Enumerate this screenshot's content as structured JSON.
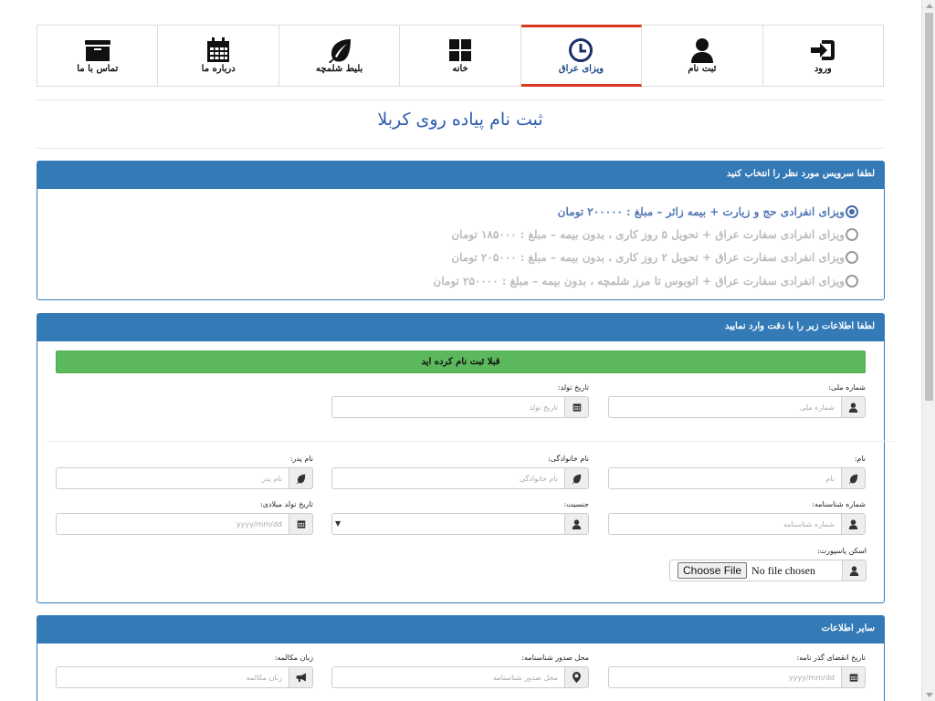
{
  "nav": {
    "items": [
      {
        "key": "login",
        "label": "ورود",
        "icon": "sign-in-icon"
      },
      {
        "key": "register",
        "label": "ثبت نام",
        "icon": "user-icon"
      },
      {
        "key": "iraq-visa",
        "label": "ویزای عراق",
        "icon": "clock-icon",
        "active": true
      },
      {
        "key": "home",
        "label": "خانه",
        "icon": "grid-icon"
      },
      {
        "key": "shalamcheh-ticket",
        "label": "بلیط شلمچه",
        "icon": "leaf-icon"
      },
      {
        "key": "about",
        "label": "درباره ما",
        "icon": "calendar-icon"
      },
      {
        "key": "contact",
        "label": "تماس با ما",
        "icon": "folder-icon"
      }
    ]
  },
  "page_title": "ثبت نام پیاده روی کربلا",
  "services_panel": {
    "title": "لطفا سرویس مورد نظر را انتخاب کنید",
    "options": [
      {
        "label": "ویزای انفرادی حج و زیارت + بیمه زائر – مبلغ : ۲۰۰۰۰۰ تومان",
        "checked": true
      },
      {
        "label": "ویزای انفرادی سفارت عراق + تحویل ۵ روز کاری ، بدون بیمه – مبلغ : ۱۸۵۰۰۰ تومان",
        "checked": false
      },
      {
        "label": "ویزای انفرادی سفارت عراق + تحویل ۲ روز کاری ، بدون بیمه – مبلغ : ۲۰۵۰۰۰ تومان",
        "checked": false
      },
      {
        "label": "ویزای انفرادی سفارت عراق + اتوبوس تا مرز شلمچه ، بدون بیمه – مبلغ : ۲۵۰۰۰۰ تومان",
        "checked": false
      }
    ]
  },
  "info_panel": {
    "title": "لطفا اطلاعات زیر را با دقت وارد نمایید",
    "alert": "قبلا ثبت نام کرده اید",
    "national_id": {
      "label": "شماره ملی:",
      "placeholder": "شماره ملی",
      "icon": "user-icon"
    },
    "birth_date": {
      "label": "تاریخ تولد:",
      "placeholder": "تاریخ تولد",
      "icon": "calendar-icon"
    },
    "first_name": {
      "label": "نام:",
      "placeholder": "نام",
      "icon": "leaf-icon"
    },
    "last_name": {
      "label": "نام خانوادگی:",
      "placeholder": "نام خانوادگی",
      "icon": "leaf-icon"
    },
    "father_name": {
      "label": "نام پدر:",
      "placeholder": "نام پدر",
      "icon": "leaf-icon"
    },
    "id_number": {
      "label": "شماره شناسنامه:",
      "placeholder": "شماره شناسنامه",
      "icon": "user-icon"
    },
    "gender": {
      "label": "جنسیت:",
      "value": "",
      "icon": "user-icon"
    },
    "birth_date_gregorian": {
      "label": "تاریخ تولد میلادی:",
      "placeholder": "yyyy/mm/dd",
      "icon": "calendar-icon"
    },
    "passport_scan": {
      "label": "اسکن پاسپورت:",
      "button": "Choose File",
      "status": "No file chosen",
      "icon": "user-icon"
    }
  },
  "other_panel": {
    "title": "سایر اطلاعات",
    "passport_expiry": {
      "label": "تاریخ انقضای گذر نامه:",
      "placeholder": "yyyy/mm/dd",
      "icon": "calendar-icon"
    },
    "id_issue_place": {
      "label": "محل صدور شناسنامه:",
      "placeholder": "محل صدور شناسنامه",
      "icon": "map-marker-icon"
    },
    "spoken_language": {
      "label": "زبان مکالمه:",
      "placeholder": "زبان مکالمه",
      "icon": "bullhorn-icon"
    }
  },
  "colors": {
    "primary": "#337ab7",
    "active_tab": "#d9381e",
    "alert_success": "#5cb85c",
    "title": "#2a5bb0"
  }
}
